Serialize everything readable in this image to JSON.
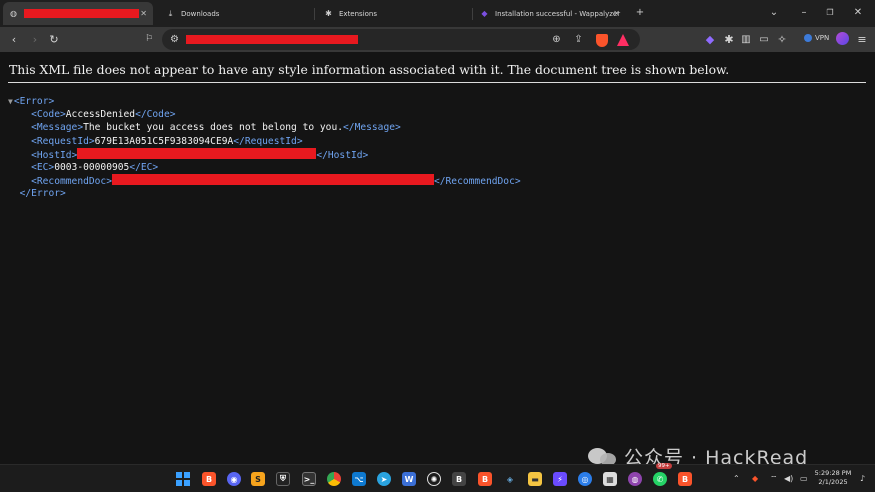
{
  "browser": {
    "tabs": [
      {
        "label": "",
        "redacted": true,
        "active": true
      },
      {
        "label": "Downloads",
        "icon": "download-icon"
      },
      {
        "label": "Extensions",
        "icon": "puzzle-icon"
      },
      {
        "label": "Installation successful - Wappalyzer",
        "icon": "wappalyzer-icon"
      }
    ],
    "new_tab_symbol": "+",
    "vpn_label": "VPN"
  },
  "page": {
    "notice": "This XML file does not appear to have any style information associated with it. The document tree is shown below.",
    "root_open": "<Error>",
    "root_close": "</Error>",
    "nodes": {
      "code": {
        "open": "<Code>",
        "value": "AccessDenied",
        "close": "</Code>"
      },
      "message": {
        "open": "<Message>",
        "value": "The bucket you access does not belong to you.",
        "close": "</Message>"
      },
      "request_id": {
        "open": "<RequestId>",
        "value": "679E13A051C5F9383094CE9A",
        "close": "</RequestId>"
      },
      "host_id": {
        "open": "<HostId>",
        "value": "",
        "redacted": true,
        "close": "</HostId>"
      },
      "ec": {
        "open": "<EC>",
        "value": "0003-00000905",
        "close": "</EC>"
      },
      "recommend_doc": {
        "open": "<RecommendDoc>",
        "value": "",
        "redacted": true,
        "close": "</RecommendDoc>"
      }
    }
  },
  "taskbar": {
    "whatsapp_badge": "99+",
    "clock_time": "5:29:28 PM",
    "clock_date": "2/1/2025"
  },
  "watermark": {
    "text": "公众号 · HackRead"
  },
  "colors": {
    "redaction": "#e8191f",
    "xml_tag": "#6fa3ef",
    "page_bg": "#141414"
  }
}
